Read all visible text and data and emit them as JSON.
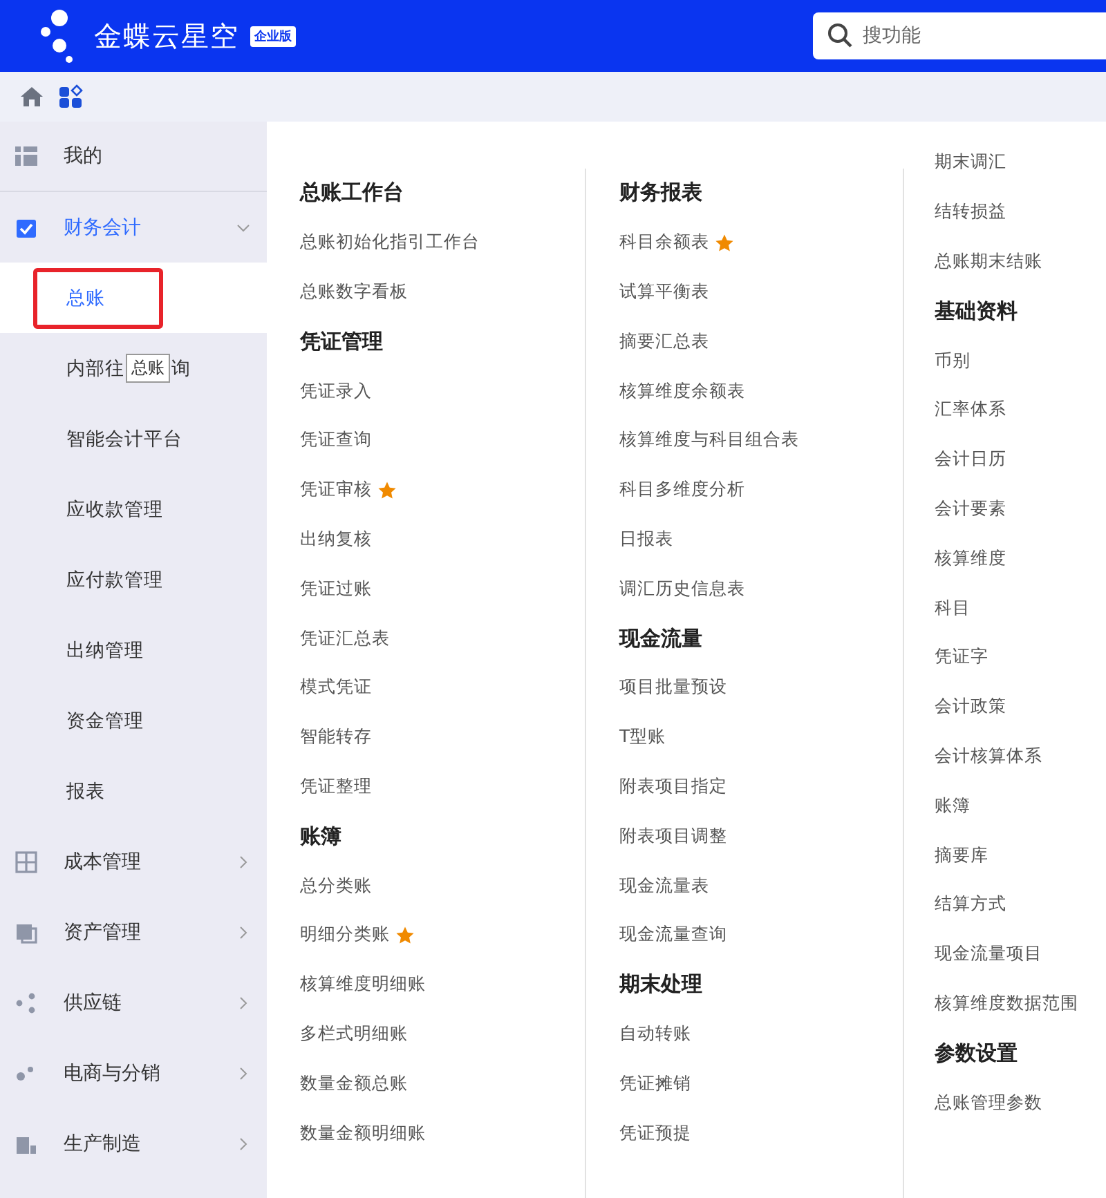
{
  "header": {
    "brand": "金蝶云星空",
    "edition": "企业版",
    "search": {
      "placeholder": "搜功能"
    }
  },
  "sidebar": {
    "items": [
      {
        "label": "我的"
      },
      {
        "label": "财务会计",
        "expanded": true,
        "children": [
          {
            "label": "总账",
            "selected": true,
            "outlined": true
          },
          {
            "label": "内部往",
            "label_end": "询",
            "selected": false,
            "outlined": false,
            "tooltip": "总账"
          },
          {
            "label": "智能会计平台",
            "selected": false,
            "outlined": false
          },
          {
            "label": "应收款管理",
            "selected": false,
            "outlined": false
          },
          {
            "label": "应付款管理",
            "selected": false,
            "outlined": false
          },
          {
            "label": "出纳管理",
            "selected": false,
            "outlined": false
          },
          {
            "label": "资金管理",
            "selected": false,
            "outlined": false
          },
          {
            "label": "报表",
            "selected": false,
            "outlined": false
          }
        ]
      },
      {
        "label": "成本管理",
        "expanded": false
      },
      {
        "label": "资产管理",
        "expanded": false
      },
      {
        "label": "供应链",
        "expanded": false
      },
      {
        "label": "电商与分销",
        "expanded": false
      },
      {
        "label": "生产制造",
        "expanded": false
      }
    ]
  },
  "menu_columns": [
    {
      "entries": [
        {
          "kind": "heading",
          "text": "总账工作台"
        },
        {
          "kind": "item",
          "text": "总账初始化指引工作台",
          "starred": false
        },
        {
          "kind": "item",
          "text": "总账数字看板",
          "starred": false
        },
        {
          "kind": "heading",
          "text": "凭证管理"
        },
        {
          "kind": "item",
          "text": "凭证录入",
          "starred": false
        },
        {
          "kind": "item",
          "text": "凭证查询",
          "starred": false
        },
        {
          "kind": "item",
          "text": "凭证审核",
          "starred": true
        },
        {
          "kind": "item",
          "text": "出纳复核",
          "starred": false
        },
        {
          "kind": "item",
          "text": "凭证过账",
          "starred": false
        },
        {
          "kind": "item",
          "text": "凭证汇总表",
          "starred": false
        },
        {
          "kind": "item",
          "text": "模式凭证",
          "starred": false
        },
        {
          "kind": "item",
          "text": "智能转存",
          "starred": false
        },
        {
          "kind": "item",
          "text": "凭证整理",
          "starred": false
        },
        {
          "kind": "heading",
          "text": "账簿"
        },
        {
          "kind": "item",
          "text": "总分类账",
          "starred": false
        },
        {
          "kind": "item",
          "text": "明细分类账",
          "starred": true
        },
        {
          "kind": "item",
          "text": "核算维度明细账",
          "starred": false
        },
        {
          "kind": "item",
          "text": "多栏式明细账",
          "starred": false
        },
        {
          "kind": "item",
          "text": "数量金额总账",
          "starred": false
        },
        {
          "kind": "item",
          "text": "数量金额明细账",
          "starred": false
        }
      ]
    },
    {
      "entries": [
        {
          "kind": "heading",
          "text": "财务报表"
        },
        {
          "kind": "item",
          "text": "科目余额表",
          "starred": true
        },
        {
          "kind": "item",
          "text": "试算平衡表",
          "starred": false
        },
        {
          "kind": "item",
          "text": "摘要汇总表",
          "starred": false
        },
        {
          "kind": "item",
          "text": "核算维度余额表",
          "starred": false
        },
        {
          "kind": "item",
          "text": "核算维度与科目组合表",
          "starred": false
        },
        {
          "kind": "item",
          "text": "科目多维度分析",
          "starred": false
        },
        {
          "kind": "item",
          "text": "日报表",
          "starred": false
        },
        {
          "kind": "item",
          "text": "调汇历史信息表",
          "starred": false
        },
        {
          "kind": "heading",
          "text": "现金流量"
        },
        {
          "kind": "item",
          "text": "项目批量预设",
          "starred": false
        },
        {
          "kind": "item",
          "text": "T型账",
          "starred": false
        },
        {
          "kind": "item",
          "text": "附表项目指定",
          "starred": false
        },
        {
          "kind": "item",
          "text": "附表项目调整",
          "starred": false
        },
        {
          "kind": "item",
          "text": "现金流量表",
          "starred": false
        },
        {
          "kind": "item",
          "text": "现金流量查询",
          "starred": false
        },
        {
          "kind": "heading",
          "text": "期末处理"
        },
        {
          "kind": "item",
          "text": "自动转账",
          "starred": false
        },
        {
          "kind": "item",
          "text": "凭证摊销",
          "starred": false
        },
        {
          "kind": "item",
          "text": "凭证预提",
          "starred": false
        }
      ]
    },
    {
      "entries": [
        {
          "kind": "item",
          "text": "期末调汇",
          "starred": false
        },
        {
          "kind": "item",
          "text": "结转损益",
          "starred": false
        },
        {
          "kind": "item",
          "text": "总账期末结账",
          "starred": false
        },
        {
          "kind": "heading",
          "text": "基础资料"
        },
        {
          "kind": "item",
          "text": "币别",
          "starred": false
        },
        {
          "kind": "item",
          "text": "汇率体系",
          "starred": false
        },
        {
          "kind": "item",
          "text": "会计日历",
          "starred": false
        },
        {
          "kind": "item",
          "text": "会计要素",
          "starred": false
        },
        {
          "kind": "item",
          "text": "核算维度",
          "starred": false
        },
        {
          "kind": "item",
          "text": "科目",
          "starred": false
        },
        {
          "kind": "item",
          "text": "凭证字",
          "starred": false
        },
        {
          "kind": "item",
          "text": "会计政策",
          "starred": false
        },
        {
          "kind": "item",
          "text": "会计核算体系",
          "starred": false
        },
        {
          "kind": "item",
          "text": "账簿",
          "starred": false
        },
        {
          "kind": "item",
          "text": "摘要库",
          "starred": false
        },
        {
          "kind": "item",
          "text": "结算方式",
          "starred": false
        },
        {
          "kind": "item",
          "text": "现金流量项目",
          "starred": false
        },
        {
          "kind": "item",
          "text": "核算维度数据范围",
          "starred": false
        },
        {
          "kind": "heading",
          "text": "参数设置"
        },
        {
          "kind": "item",
          "text": "总账管理参数",
          "starred": false
        }
      ]
    }
  ]
}
